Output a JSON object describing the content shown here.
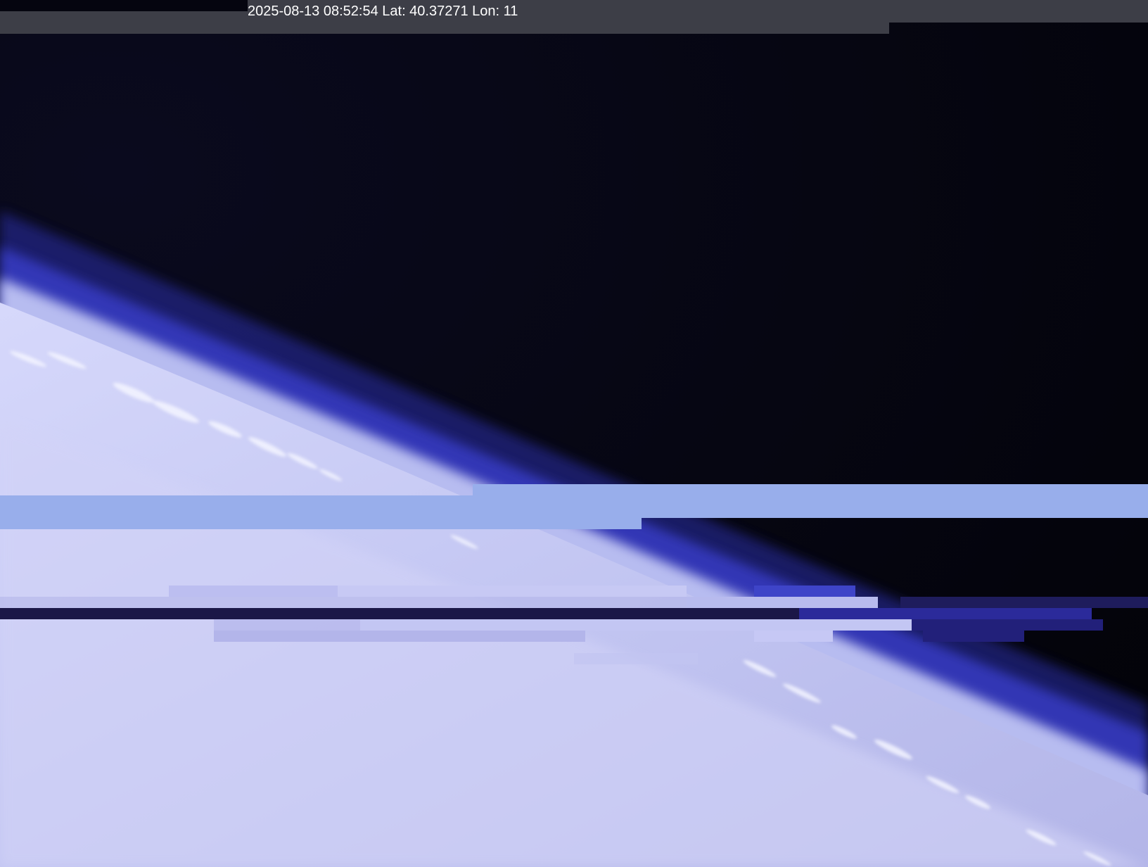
{
  "overlay": {
    "timestamp_coords": "2025-08-13 08:52:54 Lat: 40.37271 Lon: 11"
  },
  "scene": {
    "description_colors": {
      "space": "#05050f",
      "horizon_glow": "#3a3fd6",
      "atmosphere": "#c9cdf5",
      "clouds": "#e6e8ff"
    }
  },
  "glitch": {
    "header_color": "#3d3e47",
    "band_color": "#98aeeb",
    "dark_band_color": "#1b1747"
  }
}
